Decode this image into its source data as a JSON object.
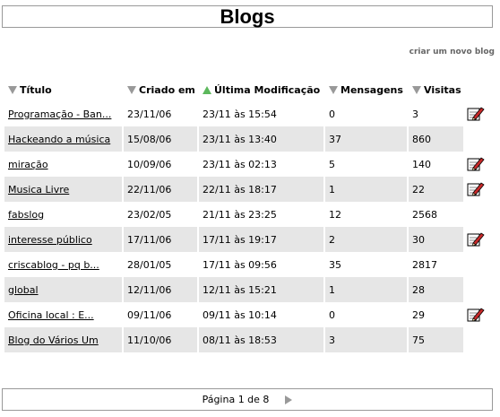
{
  "page": {
    "title": "Blogs",
    "new_blog_link": "criar um novo blog"
  },
  "table": {
    "headers": {
      "title": "Título",
      "created": "Criado em",
      "modified": "Última Modificação",
      "messages": "Mensagens",
      "visits": "Visitas"
    },
    "rows": [
      {
        "title": "Programação - Ban...",
        "created": "23/11/06",
        "modified": "23/11 às 15:54",
        "messages": "0",
        "visits": "3",
        "editable": true
      },
      {
        "title": "Hackeando a música",
        "created": "15/08/06",
        "modified": "23/11 às 13:40",
        "messages": "37",
        "visits": "860",
        "editable": false
      },
      {
        "title": "miração",
        "created": "10/09/06",
        "modified": "23/11 às 02:13",
        "messages": "5",
        "visits": "140",
        "editable": true
      },
      {
        "title": "Musica Livre",
        "created": "22/11/06",
        "modified": "22/11 às 18:17",
        "messages": "1",
        "visits": "22",
        "editable": true
      },
      {
        "title": "fabslog",
        "created": "23/02/05",
        "modified": "21/11 às 23:25",
        "messages": "12",
        "visits": "2568",
        "editable": false
      },
      {
        "title": "interesse público",
        "created": "17/11/06",
        "modified": "17/11 às 19:17",
        "messages": "2",
        "visits": "30",
        "editable": true
      },
      {
        "title": "criscablog - pq b...",
        "created": "28/01/05",
        "modified": "17/11 às 09:56",
        "messages": "35",
        "visits": "2817",
        "editable": false
      },
      {
        "title": "global",
        "created": "12/11/06",
        "modified": "12/11 às 15:21",
        "messages": "1",
        "visits": "28",
        "editable": false
      },
      {
        "title": "Oficina local : E...",
        "created": "09/11/06",
        "modified": "09/11 às 10:14",
        "messages": "0",
        "visits": "29",
        "editable": true
      },
      {
        "title": "Blog do Vários Um",
        "created": "11/10/06",
        "modified": "08/11 às 18:53",
        "messages": "3",
        "visits": "75",
        "editable": false
      }
    ]
  },
  "pagination": {
    "label": "Página 1 de 8"
  },
  "icons": {
    "sort": "sort-arrow-icon",
    "edit": "edit-pencil-icon",
    "next": "next-page-icon"
  },
  "colors": {
    "sort_active": "#5cb85c",
    "sort_inactive": "#999999",
    "row_alt": "#e6e6e6"
  }
}
